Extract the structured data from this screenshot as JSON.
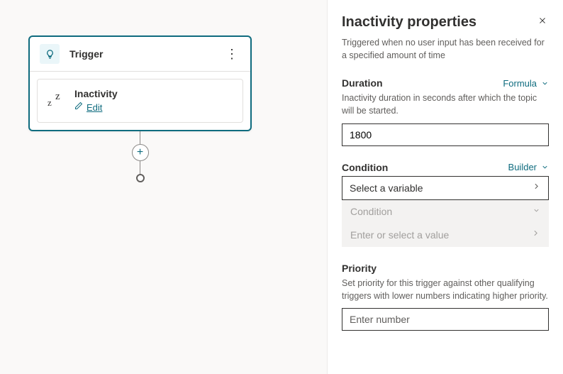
{
  "canvas": {
    "trigger": {
      "title": "Trigger",
      "item_label": "Inactivity",
      "edit_label": "Edit"
    }
  },
  "panel": {
    "title": "Inactivity properties",
    "description": "Triggered when no user input has been received for a specified amount of time"
  },
  "duration": {
    "title": "Duration",
    "mode": "Formula",
    "description": "Inactivity duration in seconds after which the topic will be started.",
    "value": "1800"
  },
  "condition": {
    "title": "Condition",
    "mode": "Builder",
    "variable_placeholder": "Select a variable",
    "condition_label": "Condition",
    "value_placeholder": "Enter or select a value"
  },
  "priority": {
    "title": "Priority",
    "description": "Set priority for this trigger against other qualifying triggers with lower numbers indicating higher priority.",
    "placeholder": "Enter number"
  }
}
